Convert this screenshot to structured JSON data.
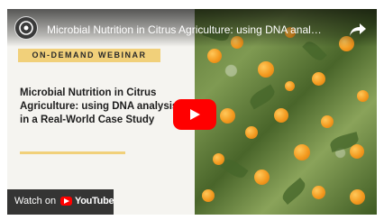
{
  "video": {
    "title": "Microbial Nutrition in Citrus Agriculture: using DNA analysis in a Real-World Case Study",
    "badge": "ON-DEMAND WEBINAR",
    "headline": "Microbial Nutrition in Citrus Agriculture: using DNA analysis in a Real-World Case Study",
    "watch_on_label": "Watch on",
    "platform_name": "YouTube"
  },
  "icons": {
    "channel": "channel-avatar-icon",
    "share": "share-icon",
    "play": "play-icon",
    "youtube": "youtube-logo-icon"
  },
  "colors": {
    "accent": "#f1d07a",
    "play_button": "#ff0000",
    "orange_fruit": "#f39a1f"
  }
}
